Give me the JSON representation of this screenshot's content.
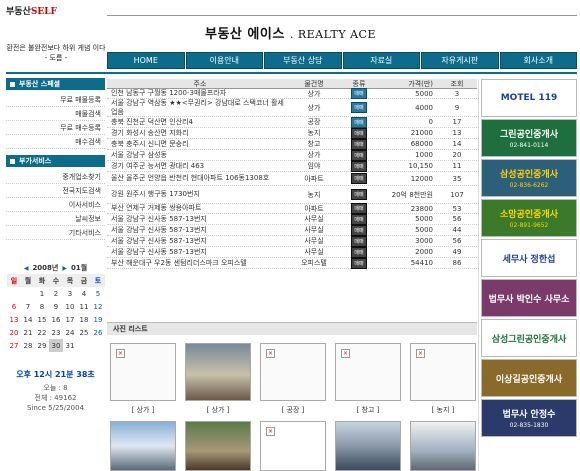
{
  "logo": {
    "main": "부동산",
    "self": "SELF"
  },
  "site": {
    "title": "부동산 에이스",
    "title_en": ". REALTY ACE",
    "tagline": "환전은 불완전보다 하위 게념 이다 - 도름 -"
  },
  "nav": [
    "HOME",
    "이용안내",
    "부동산 상담",
    "자료실",
    "자유게시판",
    "회사소개"
  ],
  "sidebar": {
    "section1": {
      "title": "부동산 스페셜",
      "items": [
        "무료 매물등록",
        "매물검색",
        "무료 매수등록",
        "매수검색"
      ]
    },
    "section2": {
      "title": "부가서비스",
      "items": [
        "중개업소찾기",
        "전국지도검색",
        "이사서비스",
        "날씨정보",
        "기타서비스"
      ]
    }
  },
  "calendar": {
    "title": "2008년",
    "month": "01월",
    "days": [
      "일",
      "월",
      "화",
      "수",
      "목",
      "금",
      "토"
    ],
    "dates": [
      "",
      "",
      "1",
      "2",
      "3",
      "4",
      "5",
      "6",
      "7",
      "8",
      "9",
      "10",
      "11",
      "12",
      "13",
      "14",
      "15",
      "16",
      "17",
      "18",
      "19",
      "20",
      "21",
      "22",
      "23",
      "24",
      "25",
      "26",
      "27",
      "28",
      "29",
      "30",
      "31",
      "",
      ""
    ],
    "today": "30"
  },
  "clock": "오후 12시 21분 38초",
  "stats": {
    "today": "오늘 : 8",
    "total": "전체 : 49162",
    "since": "Since 5/25/2004"
  },
  "table": {
    "headers": {
      "addr": "주소",
      "type": "물건명",
      "kind": "종류",
      "price": "가격(만)",
      "view": "조회"
    },
    "rows": [
      {
        "addr": "인천 남동구 구월동 1200-3매몰프라자",
        "type": "상가",
        "kind": "매매",
        "price": "5000",
        "view": "3"
      },
      {
        "addr": "서울 강남구 역삼동 ★★<무권리> 강남대로 스택코너 활세업음",
        "type": "상가",
        "kind": "매매",
        "price": "4000",
        "view": "9"
      },
      {
        "addr": "충북 진천군 덕산면 인산리4",
        "type": "공장",
        "kind": "매매",
        "price": "0",
        "view": "17"
      },
      {
        "addr": "경기 화성시 송산면 지화리",
        "type": "농지",
        "kind": "매매",
        "price": "21000",
        "view": "13"
      },
      {
        "addr": "충북 충주시 신니면 문숭리",
        "type": "창고",
        "kind": "매매",
        "price": "68000",
        "view": "14"
      },
      {
        "addr": "서울 강남구 삼성동",
        "type": "상가",
        "kind": "매매",
        "price": "1000",
        "view": "20"
      },
      {
        "addr": "경기 여주군 능서면 광대리 463",
        "type": "임야",
        "kind": "매매",
        "price": "10,150",
        "view": "11"
      },
      {
        "addr": "울산 울주군 언양읍 반천리 현대아파트 106동1308호",
        "type": "아파트",
        "kind": "매매",
        "price": "12000",
        "view": "35"
      },
      {
        "addr": "강원 원주시 행구동 1730번지",
        "type": "농지",
        "kind": "매매",
        "price": "20억 8천만원",
        "view": "107"
      },
      {
        "addr": "부산 연제구 거제동 쌍용아파트",
        "type": "아파트",
        "kind": "매매",
        "price": "23800",
        "view": "53"
      },
      {
        "addr": "서울 강남구 신사동 587-13번지",
        "type": "사무실",
        "kind": "매매",
        "price": "5000",
        "view": "56"
      },
      {
        "addr": "서울 강남구 신사동 587-13번지",
        "type": "사무실",
        "kind": "매매",
        "price": "5000",
        "view": "44"
      },
      {
        "addr": "서울 강남구 신사동 587-13번지",
        "type": "사무실",
        "kind": "매매",
        "price": "3000",
        "view": "56"
      },
      {
        "addr": "서울 강남구 신사동 587-13번지",
        "type": "사무실",
        "kind": "매매",
        "price": "2000",
        "view": "49"
      },
      {
        "addr": "부산 해운대구 우2동 센텀리더스마크 오피스텔",
        "type": "오피스텔",
        "kind": "매매",
        "price": "54410",
        "view": "86"
      }
    ]
  },
  "photos": {
    "title": "사진 리스트",
    "captions": [
      "[ 상가 ]",
      "[ 상가 ]",
      "[ 공장 ]",
      "[ 창고 ]",
      "[ 농지 ]"
    ]
  },
  "ads": [
    {
      "title": "MOTEL 119",
      "sub": "",
      "bg": "#ffffff",
      "fg": "#1a3fa0"
    },
    {
      "title": "그린공인중개사",
      "sub": "02-841-0114",
      "bg": "#1e6f3d",
      "fg": "#ffffff"
    },
    {
      "title": "삼성공인중개사",
      "sub": "02-836-6262",
      "bg": "#2c5f7a",
      "fg": "#ffd400"
    },
    {
      "title": "소망공인중개사",
      "sub": "02-891-9652",
      "bg": "#3a7a2a",
      "fg": "#ffd400"
    },
    {
      "title": "세무사 정한섭",
      "sub": "",
      "bg": "#ffffff",
      "fg": "#1a3fa0"
    },
    {
      "title": "법무사 박인수 사무소",
      "sub": "",
      "bg": "#7a3a6a",
      "fg": "#ffffff"
    },
    {
      "title": "삼성그린공인중개사",
      "sub": "",
      "bg": "#ffffff",
      "fg": "#1e6f3d"
    },
    {
      "title": "이상길공인중개사",
      "sub": "",
      "bg": "#8a6a2a",
      "fg": "#ffffff"
    },
    {
      "title": "법무사 안정수",
      "sub": "02-835-1830",
      "bg": "#2a3a6a",
      "fg": "#ffffff"
    }
  ]
}
